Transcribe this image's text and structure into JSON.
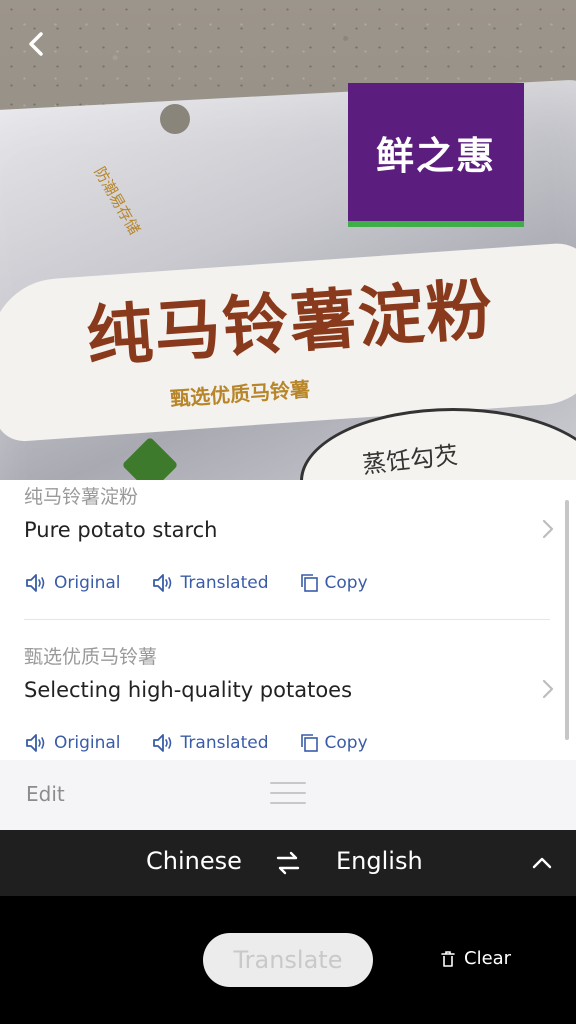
{
  "photo": {
    "brand_text": "鲜之惠",
    "product_title_cn": "纯马铃薯淀粉",
    "product_subtitle_cn": "甄选优质马铃薯",
    "side_text_cn": "防潮易存储",
    "sticker_text_cn": "蒸饪勾芡"
  },
  "results": [
    {
      "source": "纯马铃薯淀粉",
      "translation": "Pure potato starch",
      "actions": {
        "original": "Original",
        "translated": "Translated",
        "copy": "Copy"
      }
    },
    {
      "source": "甄选优质马铃薯",
      "translation": "Selecting high-quality potatoes",
      "actions": {
        "original": "Original",
        "translated": "Translated",
        "copy": "Copy"
      }
    }
  ],
  "editbar": {
    "edit_label": "Edit"
  },
  "language": {
    "source": "Chinese",
    "target": "English"
  },
  "bottom": {
    "translate_label": "Translate",
    "clear_label": "Clear"
  },
  "colors": {
    "accent": "#3a5ca8",
    "brand_purple": "#5b1e7f",
    "title_brown": "#8a3a1c"
  }
}
